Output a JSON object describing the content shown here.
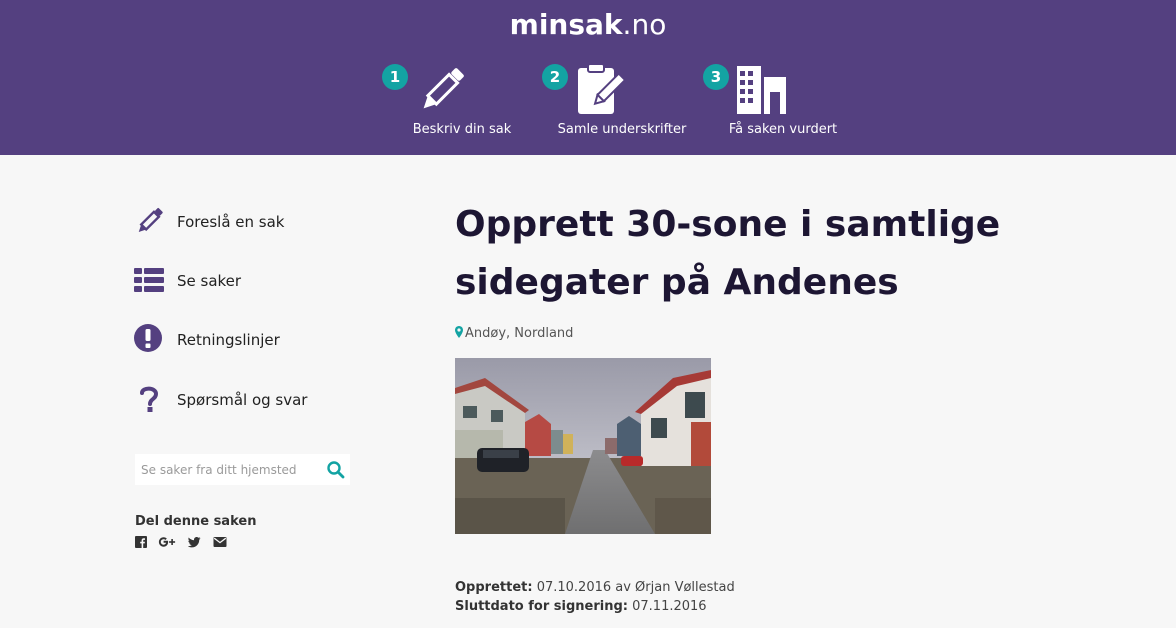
{
  "header": {
    "logo_main": "minsak",
    "logo_tld": ".no",
    "steps": [
      {
        "number": "1",
        "label": "Beskriv din sak",
        "icon": "pencil-icon"
      },
      {
        "number": "2",
        "label": "Samle underskrifter",
        "icon": "clipboard-sign-icon"
      },
      {
        "number": "3",
        "label": "Få saken vurdert",
        "icon": "building-icon"
      }
    ]
  },
  "sidebar": {
    "items": [
      {
        "label": "Foreslå en sak",
        "icon": "pencil-icon"
      },
      {
        "label": "Se saker",
        "icon": "list-icon"
      },
      {
        "label": "Retningslinjer",
        "icon": "exclamation-circle-icon"
      },
      {
        "label": "Spørsmål og svar",
        "icon": "question-icon"
      }
    ],
    "search_placeholder": "Se saker fra ditt hjemsted",
    "share_title": "Del denne saken",
    "share_icons": [
      "facebook-icon",
      "google-plus-icon",
      "twitter-icon",
      "email-icon"
    ]
  },
  "main": {
    "title": "Opprett 30-sone i samtlige sidegater på Andenes",
    "location": "Andøy, Nordland",
    "created_label": "Opprettet:",
    "created_value": "07.10.2016 av Ørjan Vøllestad",
    "deadline_label": "Sluttdato for signering:",
    "deadline_value": "07.11.2016"
  },
  "colors": {
    "header_bg": "#544080",
    "badge": "#13a3a3",
    "icon_purple": "#544080",
    "location_pin": "#13a3a3",
    "title": "#1d1633"
  }
}
